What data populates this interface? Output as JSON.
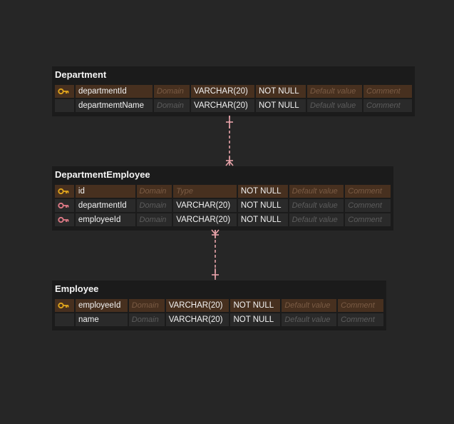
{
  "colors": {
    "background": "#262626",
    "entity_bg": "#1b1b1b",
    "pk_row": "#47301f",
    "primary_key_icon": "#e3a71c",
    "foreign_key_icon": "#e27b87",
    "relation_line": "#e7a2a8"
  },
  "entities": {
    "department": {
      "title": "Department",
      "rows": [
        {
          "key": "primary-key-icon",
          "name": "departmentId",
          "domain": "Domain",
          "type": "VARCHAR(20)",
          "nullability": "NOT NULL",
          "default": "Default value",
          "comment": "Comment"
        },
        {
          "key": "",
          "name": "departmemtName",
          "domain": "Domain",
          "type": "VARCHAR(20)",
          "nullability": "NOT NULL",
          "default": "Default value",
          "comment": "Comment"
        }
      ]
    },
    "department_employee": {
      "title": "DepartmentEmployee",
      "rows": [
        {
          "key": "primary-key-icon",
          "name": "id",
          "domain": "Domain",
          "type": "Type",
          "nullability": "NOT NULL",
          "default": "Default value",
          "comment": "Comment"
        },
        {
          "key": "foreign-key-icon",
          "name": "departmentId",
          "domain": "Domain",
          "type": "VARCHAR(20)",
          "nullability": "NOT NULL",
          "default": "Default value",
          "comment": "Comment"
        },
        {
          "key": "foreign-key-icon",
          "name": "employeeId",
          "domain": "Domain",
          "type": "VARCHAR(20)",
          "nullability": "NOT NULL",
          "default": "Default value",
          "comment": "Comment"
        }
      ]
    },
    "employee": {
      "title": "Employee",
      "rows": [
        {
          "key": "primary-key-icon",
          "name": "employeeId",
          "domain": "Domain",
          "type": "VARCHAR(20)",
          "nullability": "NOT NULL",
          "default": "Default value",
          "comment": "Comment"
        },
        {
          "key": "",
          "name": "name",
          "domain": "Domain",
          "type": "VARCHAR(20)",
          "nullability": "NOT NULL",
          "default": "Default value",
          "comment": "Comment"
        }
      ]
    }
  },
  "relations": [
    {
      "from": "Department",
      "to": "DepartmentEmployee",
      "from_end": "one",
      "to_end": "many"
    },
    {
      "from": "Employee",
      "to": "DepartmentEmployee",
      "from_end": "one",
      "to_end": "many"
    }
  ]
}
